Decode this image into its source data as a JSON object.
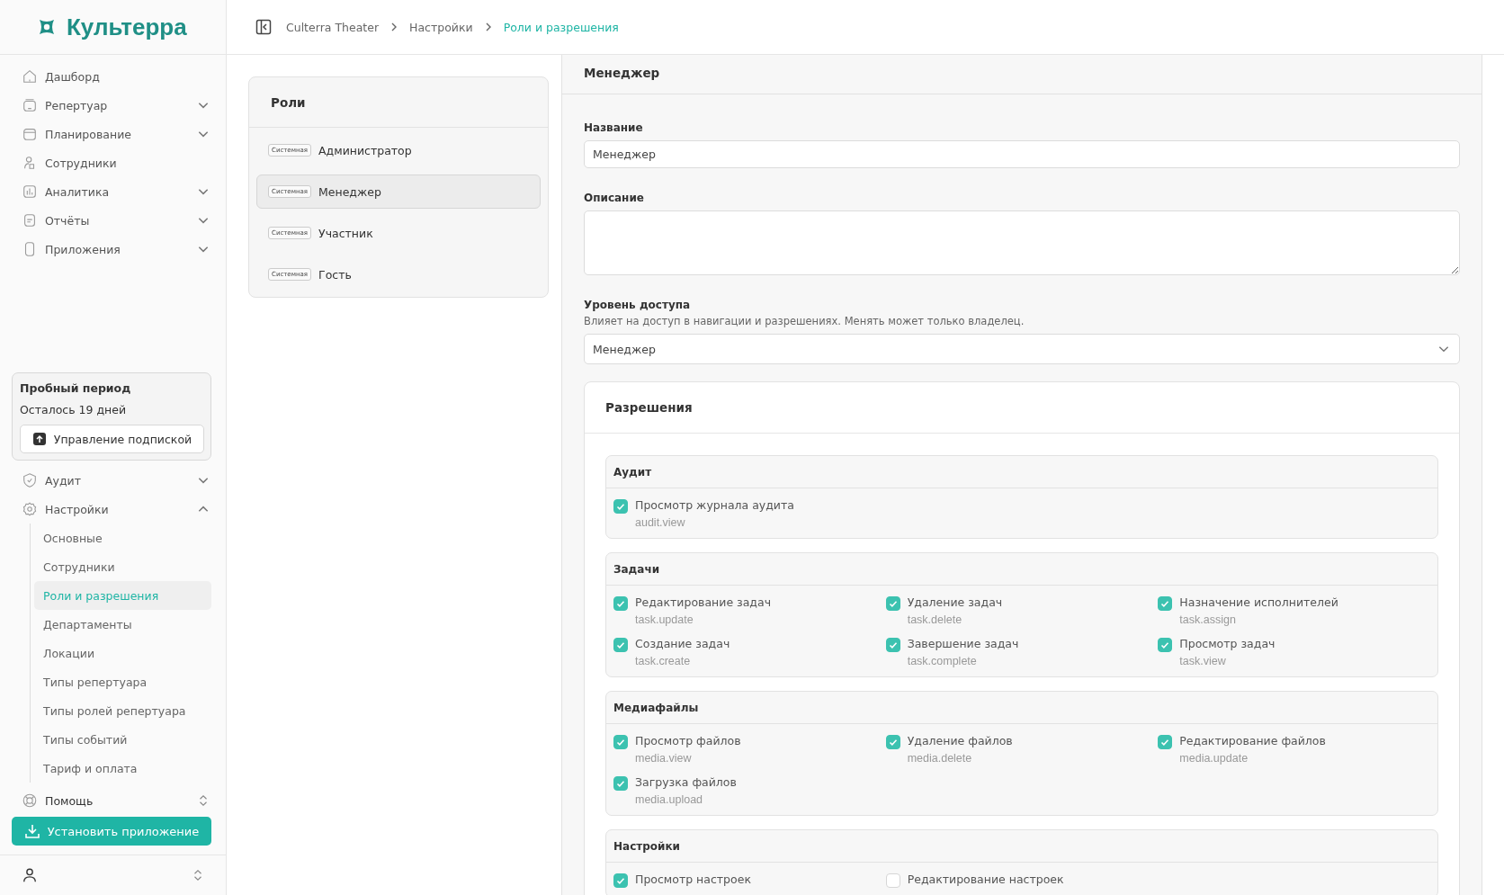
{
  "sidebar": {
    "logo": "Культерра",
    "nav": [
      {
        "label": "Дашборд",
        "kind": "link"
      },
      {
        "label": "Репертуар",
        "kind": "group",
        "expanded": false
      },
      {
        "label": "Планирование",
        "kind": "group",
        "expanded": false
      },
      {
        "label": "Сотрудники",
        "kind": "link"
      },
      {
        "label": "Аналитика",
        "kind": "group",
        "expanded": false
      },
      {
        "label": "Отчёты",
        "kind": "group",
        "expanded": false
      },
      {
        "label": "Приложения",
        "kind": "group",
        "expanded": false
      }
    ],
    "trial": {
      "title": "Пробный период",
      "remaining": "Осталось 19 дней",
      "button": "Управление подпиской"
    },
    "nav_lower": [
      {
        "label": "Аудит",
        "kind": "group",
        "expanded": false
      },
      {
        "label": "Настройки",
        "kind": "group",
        "expanded": true,
        "children": [
          {
            "label": "Основные",
            "selected": false
          },
          {
            "label": "Сотрудники",
            "selected": false
          },
          {
            "label": "Роли и разрешения",
            "selected": true
          },
          {
            "label": "Департаменты",
            "selected": false
          },
          {
            "label": "Локации",
            "selected": false
          },
          {
            "label": "Типы репертуара",
            "selected": false
          },
          {
            "label": "Типы ролей репертуара",
            "selected": false
          },
          {
            "label": "Типы событий",
            "selected": false
          },
          {
            "label": "Тариф и оплата",
            "selected": false
          }
        ]
      }
    ],
    "help": "Помощь",
    "install_button": "Установить приложение"
  },
  "breadcrumbs": [
    {
      "label": "Culterra Theater",
      "current": false
    },
    {
      "label": "Настройки",
      "current": false
    },
    {
      "label": "Роли и разрешения",
      "current": true
    }
  ],
  "roles": {
    "title": "Роли",
    "items": [
      {
        "badge": "Системная",
        "name": "Администратор",
        "selected": false
      },
      {
        "badge": "Системная",
        "name": "Менеджер",
        "selected": true
      },
      {
        "badge": "Системная",
        "name": "Участник",
        "selected": false
      },
      {
        "badge": "Системная",
        "name": "Гость",
        "selected": false
      }
    ]
  },
  "detail": {
    "title": "Менеджер",
    "name_label": "Название",
    "name_value": "Менеджер",
    "description_label": "Описание",
    "access_label": "Уровень доступа",
    "access_hint": "Влияет на доступ в навигации и разрешениях. Менять может только владелец.",
    "access_value": "Менеджер"
  },
  "permissions": {
    "title": "Разрешения",
    "groups": [
      {
        "title": "Аудит",
        "items": [
          {
            "label": "Просмотр журнала аудита",
            "code": "audit.view",
            "checked": true
          }
        ]
      },
      {
        "title": "Задачи",
        "items": [
          {
            "label": "Редактирование задач",
            "code": "task.update",
            "checked": true
          },
          {
            "label": "Удаление задач",
            "code": "task.delete",
            "checked": true
          },
          {
            "label": "Назначение исполнителей",
            "code": "task.assign",
            "checked": true
          },
          {
            "label": "Создание задач",
            "code": "task.create",
            "checked": true
          },
          {
            "label": "Завершение задач",
            "code": "task.complete",
            "checked": true
          },
          {
            "label": "Просмотр задач",
            "code": "task.view",
            "checked": true
          }
        ]
      },
      {
        "title": "Медиафайлы",
        "items": [
          {
            "label": "Просмотр файлов",
            "code": "media.view",
            "checked": true
          },
          {
            "label": "Удаление файлов",
            "code": "media.delete",
            "checked": true
          },
          {
            "label": "Редактирование файлов",
            "code": "media.update",
            "checked": true
          },
          {
            "label": "Загрузка файлов",
            "code": "media.upload",
            "checked": true
          }
        ]
      },
      {
        "title": "Настройки",
        "items": [
          {
            "label": "Просмотр настроек",
            "checked": true
          },
          {
            "label": "Редактирование настроек",
            "checked": false
          }
        ]
      }
    ]
  }
}
